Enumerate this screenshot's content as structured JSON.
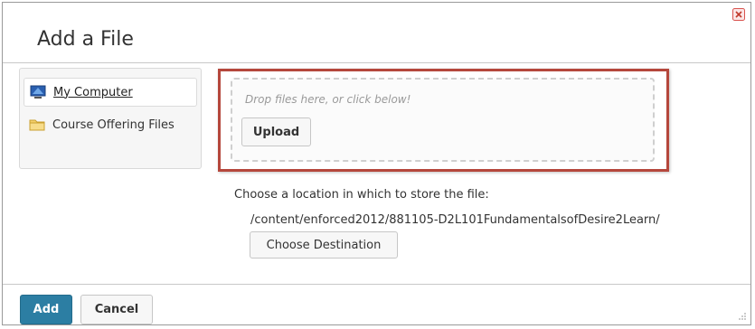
{
  "dialog": {
    "title": "Add a File",
    "close_icon": "close-icon"
  },
  "sidebar": {
    "items": [
      {
        "label": "My Computer",
        "icon": "computer-icon",
        "active": true
      },
      {
        "label": "Course Offering Files",
        "icon": "folder-icon",
        "active": false
      }
    ]
  },
  "upload": {
    "drop_text": "Drop files here, or click below!",
    "upload_label": "Upload"
  },
  "destination": {
    "prompt": "Choose a location in which to store the file:",
    "path": "/content/enforced2012/881105-D2L101FundamentalsofDesire2Learn/",
    "choose_label": "Choose Destination"
  },
  "footer": {
    "add_label": "Add",
    "cancel_label": "Cancel"
  },
  "colors": {
    "accent": "#2c7ea3",
    "highlight_border": "#b5473c",
    "close_icon": "#d9534f"
  }
}
